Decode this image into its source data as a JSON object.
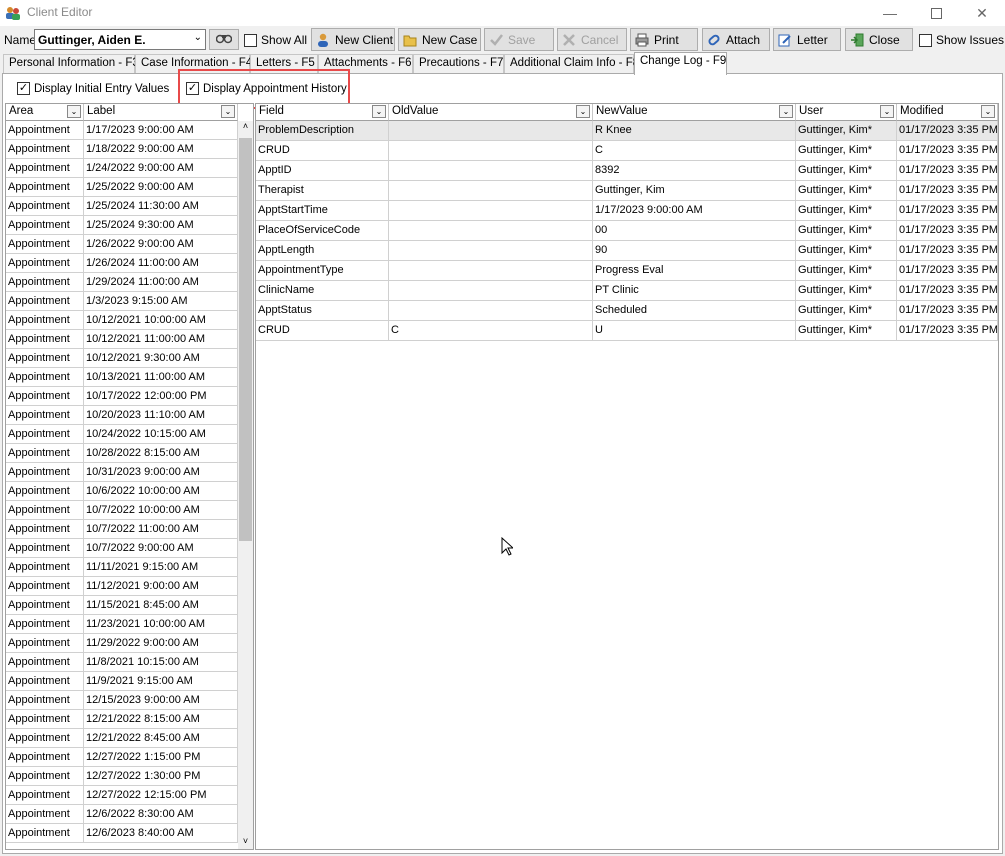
{
  "window": {
    "title": "Client Editor"
  },
  "toolbar": {
    "name_label": "Name",
    "name_value": "Guttinger, Aiden E.",
    "show_all": "Show All",
    "new_client": "New Client",
    "new_case": "New Case",
    "save": "Save",
    "cancel": "Cancel",
    "print": "Print",
    "attach": "Attach",
    "letter": "Letter",
    "close": "Close",
    "show_issues": "Show Issues"
  },
  "tabs": [
    "Personal Information - F3",
    "Case Information - F4",
    "Letters - F5",
    "Attachments - F6",
    "Precautions - F7",
    "Additional Claim Info - F8",
    "Change Log - F9"
  ],
  "options": {
    "initial_entry": "Display Initial Entry Values",
    "appointment_history": "Display Appointment History"
  },
  "left_grid": {
    "columns": [
      "Area",
      "Label"
    ],
    "rows": [
      [
        "Appointment",
        "1/17/2023 9:00:00 AM"
      ],
      [
        "Appointment",
        "1/18/2022 9:00:00 AM"
      ],
      [
        "Appointment",
        "1/24/2022 9:00:00 AM"
      ],
      [
        "Appointment",
        "1/25/2022 9:00:00 AM"
      ],
      [
        "Appointment",
        "1/25/2024 11:30:00 AM"
      ],
      [
        "Appointment",
        "1/25/2024 9:30:00 AM"
      ],
      [
        "Appointment",
        "1/26/2022 9:00:00 AM"
      ],
      [
        "Appointment",
        "1/26/2024 11:00:00 AM"
      ],
      [
        "Appointment",
        "1/29/2024 11:00:00 AM"
      ],
      [
        "Appointment",
        "1/3/2023 9:15:00 AM"
      ],
      [
        "Appointment",
        "10/12/2021 10:00:00 AM"
      ],
      [
        "Appointment",
        "10/12/2021 11:00:00 AM"
      ],
      [
        "Appointment",
        "10/12/2021 9:30:00 AM"
      ],
      [
        "Appointment",
        "10/13/2021 11:00:00 AM"
      ],
      [
        "Appointment",
        "10/17/2022 12:00:00 PM"
      ],
      [
        "Appointment",
        "10/20/2023 11:10:00 AM"
      ],
      [
        "Appointment",
        "10/24/2022 10:15:00 AM"
      ],
      [
        "Appointment",
        "10/28/2022 8:15:00 AM"
      ],
      [
        "Appointment",
        "10/31/2023 9:00:00 AM"
      ],
      [
        "Appointment",
        "10/6/2022 10:00:00 AM"
      ],
      [
        "Appointment",
        "10/7/2022 10:00:00 AM"
      ],
      [
        "Appointment",
        "10/7/2022 11:00:00 AM"
      ],
      [
        "Appointment",
        "10/7/2022 9:00:00 AM"
      ],
      [
        "Appointment",
        "11/11/2021 9:15:00 AM"
      ],
      [
        "Appointment",
        "11/12/2021 9:00:00 AM"
      ],
      [
        "Appointment",
        "11/15/2021 8:45:00 AM"
      ],
      [
        "Appointment",
        "11/23/2021 10:00:00 AM"
      ],
      [
        "Appointment",
        "11/29/2022 9:00:00 AM"
      ],
      [
        "Appointment",
        "11/8/2021 10:15:00 AM"
      ],
      [
        "Appointment",
        "11/9/2021 9:15:00 AM"
      ],
      [
        "Appointment",
        "12/15/2023 9:00:00 AM"
      ],
      [
        "Appointment",
        "12/21/2022 8:15:00 AM"
      ],
      [
        "Appointment",
        "12/21/2022 8:45:00 AM"
      ],
      [
        "Appointment",
        "12/27/2022 1:15:00 PM"
      ],
      [
        "Appointment",
        "12/27/2022 1:30:00 PM"
      ],
      [
        "Appointment",
        "12/27/2022 12:15:00 PM"
      ],
      [
        "Appointment",
        "12/6/2022 8:30:00 AM"
      ],
      [
        "Appointment",
        "12/6/2023 8:40:00 AM"
      ]
    ]
  },
  "right_grid": {
    "columns": [
      "Field",
      "OldValue",
      "NewValue",
      "User",
      "Modified"
    ],
    "rows": [
      [
        "ProblemDescription",
        "",
        "R Knee",
        "Guttinger, Kim*",
        "01/17/2023 3:35 PM"
      ],
      [
        "CRUD",
        "",
        "C",
        "Guttinger, Kim*",
        "01/17/2023 3:35 PM"
      ],
      [
        "ApptID",
        "",
        "8392",
        "Guttinger, Kim*",
        "01/17/2023 3:35 PM"
      ],
      [
        "Therapist",
        "",
        "Guttinger, Kim",
        "Guttinger, Kim*",
        "01/17/2023 3:35 PM"
      ],
      [
        "ApptStartTime",
        "",
        "1/17/2023 9:00:00 AM",
        "Guttinger, Kim*",
        "01/17/2023 3:35 PM"
      ],
      [
        "PlaceOfServiceCode",
        "",
        "00",
        "Guttinger, Kim*",
        "01/17/2023 3:35 PM"
      ],
      [
        "ApptLength",
        "",
        "90",
        "Guttinger, Kim*",
        "01/17/2023 3:35 PM"
      ],
      [
        "AppointmentType",
        "",
        "Progress Eval",
        "Guttinger, Kim*",
        "01/17/2023 3:35 PM"
      ],
      [
        "ClinicName",
        "",
        "PT Clinic",
        "Guttinger, Kim*",
        "01/17/2023 3:35 PM"
      ],
      [
        "ApptStatus",
        "",
        "Scheduled",
        "Guttinger, Kim*",
        "01/17/2023 3:35 PM"
      ],
      [
        "CRUD",
        "C",
        "U",
        "Guttinger, Kim*",
        "01/17/2023 3:35 PM"
      ]
    ]
  },
  "colors": {
    "highlight_box": "#e84a4a",
    "selected_row": "#e8e8e8"
  }
}
